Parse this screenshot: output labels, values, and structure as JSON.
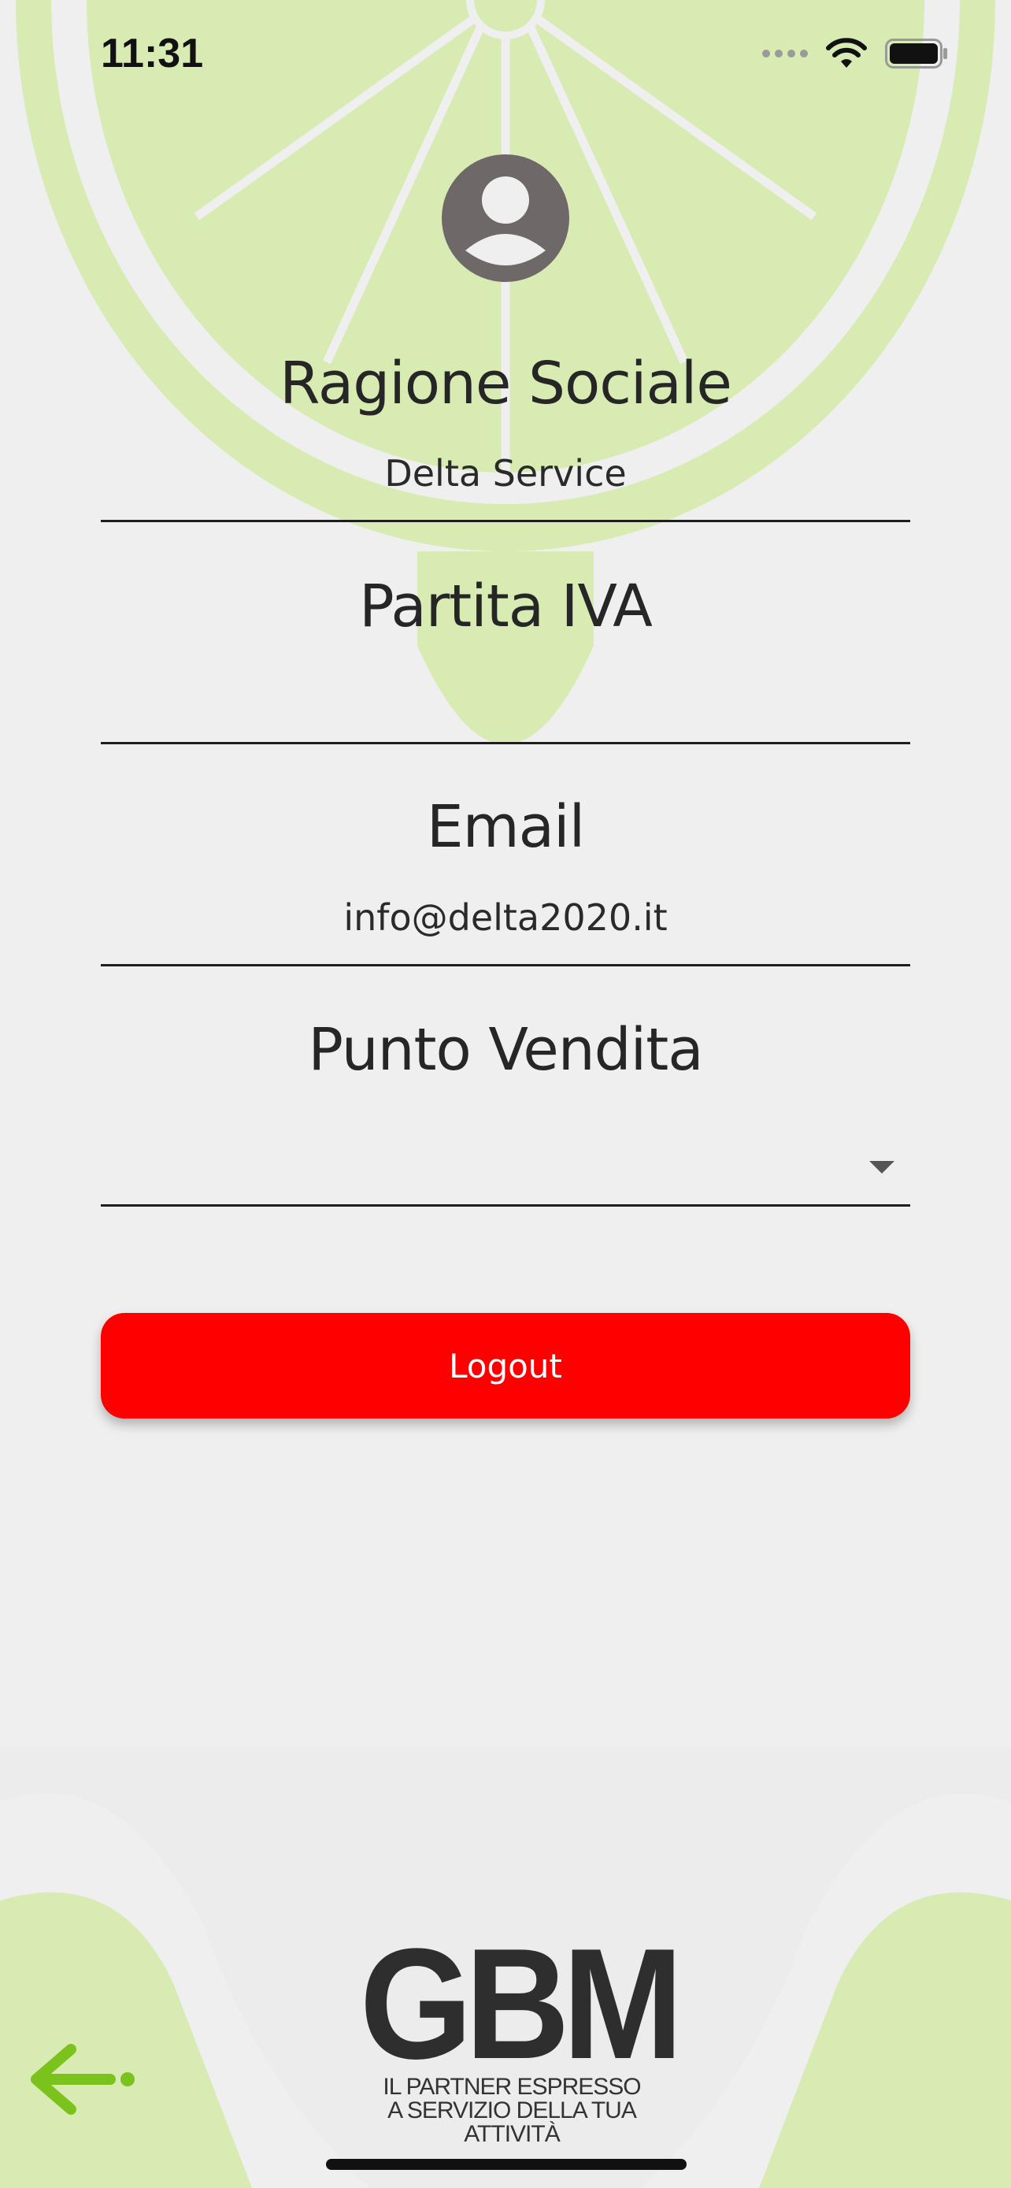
{
  "status_bar": {
    "time": "11:31"
  },
  "profile": {
    "fields": [
      {
        "label": "Ragione Sociale",
        "value": "Delta Service"
      },
      {
        "label": "Partita IVA",
        "value": ""
      },
      {
        "label": "Email",
        "value": "info@delta2020.it"
      },
      {
        "label": "Punto Vendita",
        "value": ""
      }
    ]
  },
  "actions": {
    "logout_label": "Logout"
  },
  "brand": {
    "logo_text": "GBM",
    "tagline_line1": "IL PARTNER ESPRESSO",
    "tagline_line2": "A SERVIZIO DELLA TUA ATTIVITÀ"
  },
  "icons": {
    "avatar": "account-circle-icon",
    "back": "arrow-left-icon",
    "dropdown": "caret-down-icon",
    "wifi": "wifi-icon",
    "battery": "battery-icon"
  },
  "colors": {
    "background": "#efefef",
    "lime_decor": "#d8ebb3",
    "accent_green": "#7cc21c",
    "logout": "#ff0000",
    "text": "#262626"
  }
}
